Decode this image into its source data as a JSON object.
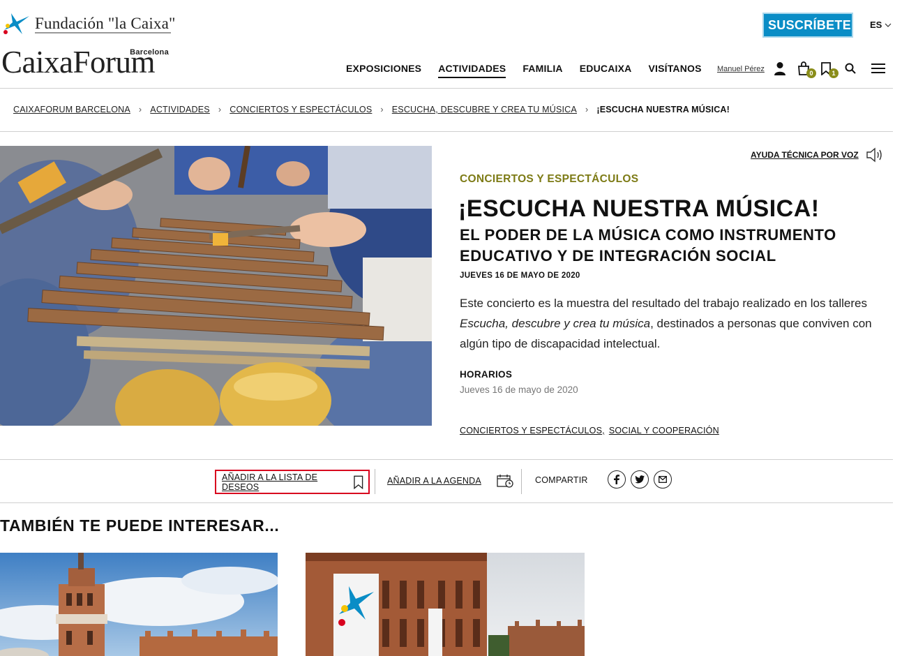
{
  "header": {
    "fundacion_name": "Fundación \"la Caixa\"",
    "logo_main": "CaixaForum",
    "logo_city": "Barcelona",
    "subscribe_label": "SUSCRÍBETE",
    "language": "ES",
    "user_name": "Manuel Pérez",
    "cart_count": "0",
    "wishlist_count": "1",
    "nav": [
      {
        "label": "EXPOSICIONES"
      },
      {
        "label": "ACTIVIDADES"
      },
      {
        "label": "FAMILIA"
      },
      {
        "label": "EDUCAIXA"
      },
      {
        "label": "VISÍTANOS"
      }
    ],
    "active_nav": "ACTIVIDADES"
  },
  "breadcrumb": {
    "items": [
      "CAIXAFORUM BARCELONA",
      "ACTIVIDADES",
      "CONCIERTOS Y ESPECTÁCULOS",
      "ESCUCHA, DESCUBRE Y CREA TU MÚSICA"
    ],
    "current": "¡ESCUCHA NUESTRA MÚSICA!",
    "separator": "›"
  },
  "event": {
    "voice_help": "AYUDA TÉCNICA POR VOZ",
    "category": "CONCIERTOS Y ESPECTÁCULOS",
    "title": "¡ESCUCHA NUESTRA MÚSICA!",
    "subtitle": "EL PODER DE LA MÚSICA COMO INSTRUMENTO EDUCATIVO Y DE INTEGRACIÓN SOCIAL",
    "date": "JUEVES 16 DE MAYO DE 2020",
    "desc_part1": "Este concierto es la muestra del resultado del trabajo realizado en los talleres ",
    "desc_italic": "Escucha, descubre y crea tu música",
    "desc_part2": ", destinados a personas que conviven con algún tipo de discapacidad intelectual.",
    "hours_label": "HORARIOS",
    "hours_value": "Jueves 16 de mayo de 2020",
    "tags": [
      "CONCIERTOS Y ESPECTÁCULOS,",
      "SOCIAL Y COOPERACIÓN"
    ]
  },
  "actions": {
    "wishlist_label": "AÑADIR A LA LISTA DE DESEOS",
    "agenda_label": "AÑADIR A LA AGENDA",
    "share_label": "COMPARTIR"
  },
  "related": {
    "heading": "TAMBIÉN TE PUEDE INTERESAR..."
  },
  "colors": {
    "brand_blue": "#0a8dc6",
    "category_olive": "#7d7b16",
    "badge_olive": "#8a8d1a",
    "highlight_red": "#d8001e"
  }
}
